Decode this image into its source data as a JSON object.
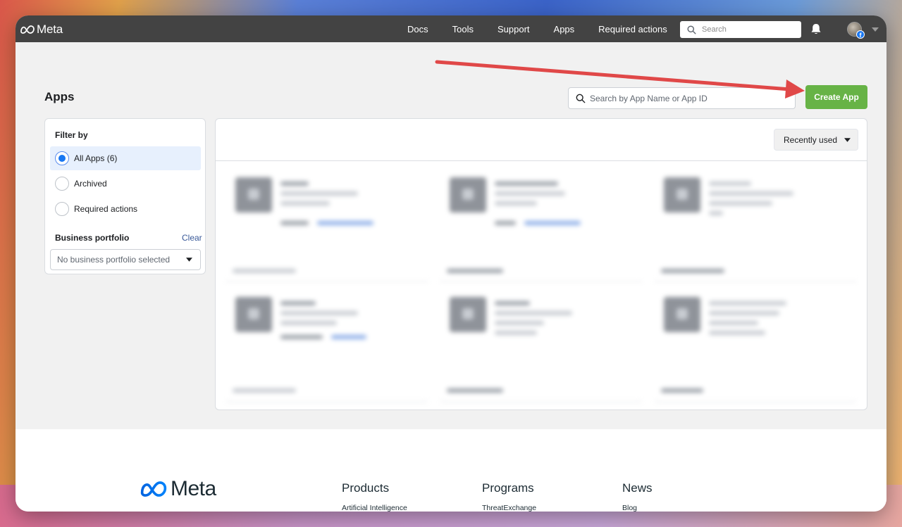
{
  "navbar": {
    "brand": "Meta",
    "links": [
      "Docs",
      "Tools",
      "Support",
      "Apps",
      "Required actions"
    ],
    "search_placeholder": "Search",
    "icons": [
      "search-icon",
      "bell-icon",
      "avatar",
      "chevron-down-icon"
    ]
  },
  "page": {
    "title": "Apps",
    "search_placeholder": "Search by App Name or App ID",
    "create_button": "Create App"
  },
  "filter": {
    "title": "Filter by",
    "options": [
      {
        "label": "All Apps (6)",
        "selected": true
      },
      {
        "label": "Archived",
        "selected": false
      },
      {
        "label": "Required actions",
        "selected": false
      }
    ],
    "business_portfolio": {
      "title": "Business portfolio",
      "clear": "Clear",
      "placeholder": "No business portfolio selected"
    }
  },
  "apps_panel": {
    "sort_label": "Recently used",
    "card_count": 6
  },
  "footer": {
    "brand": "Meta",
    "columns": [
      {
        "title": "Products",
        "link": "Artificial Intelligence"
      },
      {
        "title": "Programs",
        "link": "ThreatExchange"
      },
      {
        "title": "News",
        "link": "Blog"
      }
    ]
  },
  "colors": {
    "navbar_bg": "#434343",
    "create_button": "#67b346",
    "selected_filter_bg": "#e7f0fd",
    "annotation_arrow": "#e04848",
    "meta_blue": "#0668e1"
  }
}
